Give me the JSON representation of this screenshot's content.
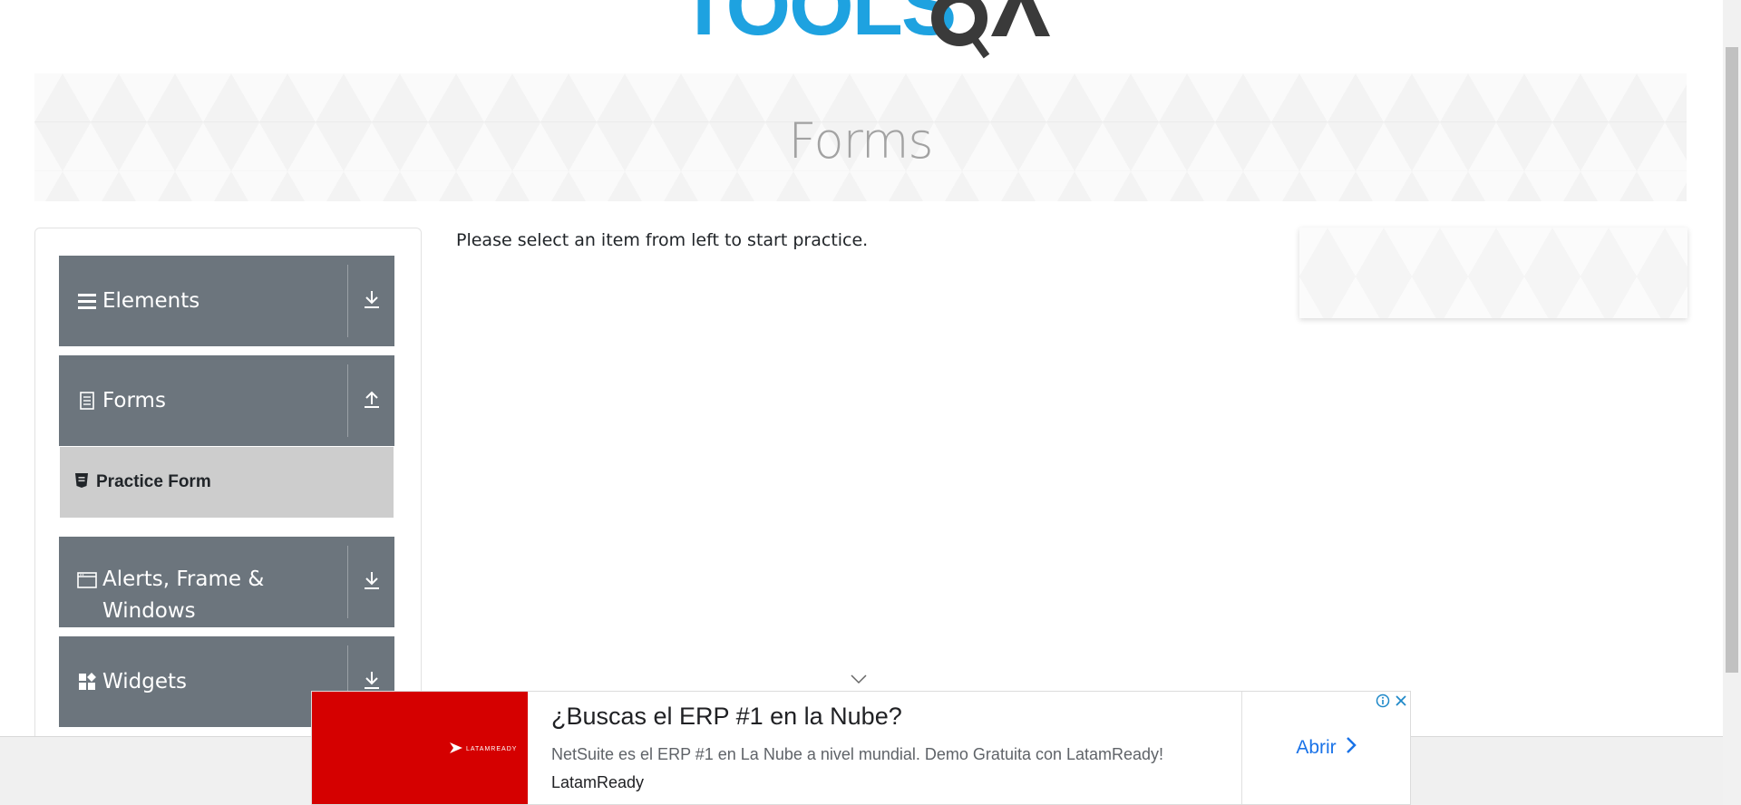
{
  "logo": {
    "text_left": "TOOLS",
    "text_right": "QA",
    "colors": {
      "tools": "#1ea2e0",
      "qa": "#3a3a3a"
    }
  },
  "banner": {
    "title": "Forms"
  },
  "sidebar": {
    "groups": [
      {
        "title": "Elements",
        "icon": "menu-lines-icon",
        "toggle_icon": "arrow-down-icon"
      },
      {
        "title": "Forms",
        "icon": "document-icon",
        "toggle_icon": "arrow-up-icon",
        "items": [
          {
            "label": "Practice Form",
            "icon": "html5-shield-icon"
          }
        ]
      },
      {
        "title": "Alerts, Frame &",
        "title_line2": "Windows",
        "icon": "window-icon",
        "toggle_icon": "arrow-down-icon"
      },
      {
        "title": "Widgets",
        "icon": "widgets-grid-icon",
        "toggle_icon": "arrow-down-icon"
      }
    ]
  },
  "main": {
    "intro_text": "Please select an item from left to start practice."
  },
  "ad": {
    "headline": "¿Buscas el ERP #1 en la Nube?",
    "description": "NetSuite es el ERP #1 en La Nube a nivel mundial. Demo Gratuita con LatamReady!",
    "advertiser": "LatamReady",
    "cta_label": "Abrir",
    "brand_small": "LATAMREADY",
    "colors": {
      "red": "#d50000",
      "cta": "#1a73e8"
    }
  },
  "colors": {
    "group_header": "#6c757d",
    "active_item": "#cdcdcd",
    "banner_title": "#a2a2a2"
  }
}
